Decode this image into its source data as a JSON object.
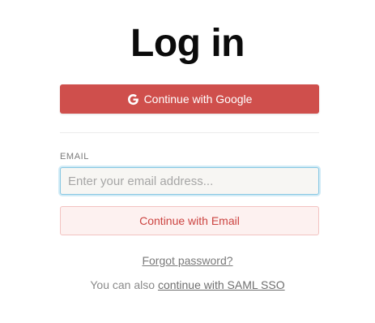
{
  "page": {
    "title": "Log in"
  },
  "google_button": {
    "label": "Continue with Google",
    "icon": "google-g-icon",
    "color": "#cf4f4c"
  },
  "email_section": {
    "label": "EMAIL",
    "placeholder": "Enter your email address...",
    "value": ""
  },
  "email_button": {
    "label": "Continue with Email",
    "color": "#cc4441"
  },
  "links": {
    "forgot_password": "Forgot password?",
    "saml_prefix": "You can also",
    "saml_link": "continue with SAML SSO"
  }
}
